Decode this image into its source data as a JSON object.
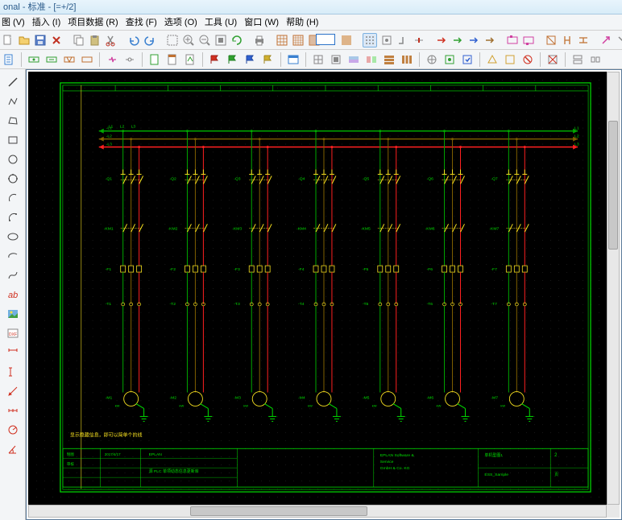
{
  "title": "onal - 标准 - [=+/2]",
  "menu": {
    "view": "图 (V)",
    "insert": "插入 (I)",
    "projdata": "项目数据 (R)",
    "find": "查找 (F)",
    "options": "选项 (O)",
    "tools": "工具 (U)",
    "window": "窗口 (W)",
    "help": "帮助 (H)"
  },
  "bus_labels_left": [
    "-L1",
    "-L2",
    "-L3"
  ],
  "bus_labels_right": [
    "L1",
    "L2",
    "L3"
  ],
  "bus_top_labels": [
    "L1",
    "L2",
    "L3"
  ],
  "note_text": "显示隐藏信息，即可以简单个的线",
  "title_block": {
    "left_a": "制图",
    "left_b": "审核",
    "date": "2017/4/17",
    "company": "EPLAN",
    "desc": "源 PLC 单项动态信息更新库",
    "center1": "EPLAN Software &",
    "center2": "Service",
    "center3": "GmbH & Co. KG",
    "proj": "单机型图1",
    "page_a": "2",
    "page_b": "页",
    "sheet": "ESS_Sample"
  },
  "columns": [
    {
      "q": "-Q1",
      "km": "-KM1",
      "f": "-F1",
      "t": "-T1",
      "m": "-M1",
      "kw": "kW"
    },
    {
      "q": "-Q2",
      "km": "-KM2",
      "f": "-F2",
      "t": "-T2",
      "m": "-M2",
      "kw": "kW"
    },
    {
      "q": "-Q3",
      "km": "-KM3",
      "f": "-F3",
      "t": "-T3",
      "m": "-M3",
      "kw": "kW"
    },
    {
      "q": "-Q4",
      "km": "-KM4",
      "f": "-F4",
      "t": "-T4",
      "m": "-M4",
      "kw": "kW"
    },
    {
      "q": "-Q5",
      "km": "-KM5",
      "f": "-F5",
      "t": "-T5",
      "m": "-M5",
      "kw": "kW"
    },
    {
      "q": "-Q6",
      "km": "-KM6",
      "f": "-F6",
      "t": "-T6",
      "m": "-M6",
      "kw": "kW"
    },
    {
      "q": "-Q7",
      "km": "-KM7",
      "f": "-F7",
      "t": "-T7",
      "m": "-M7",
      "kw": "kW"
    }
  ]
}
